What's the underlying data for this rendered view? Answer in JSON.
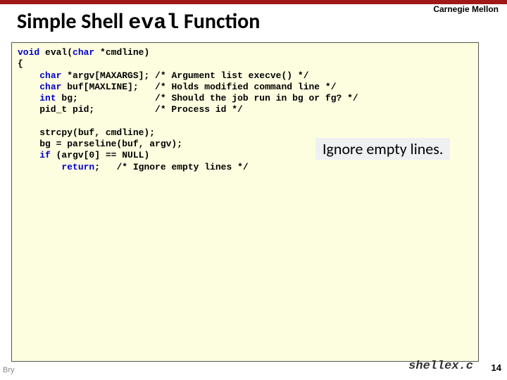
{
  "header": {
    "university": "Carnegie Mellon",
    "title_pre": "Simple Shell ",
    "title_code": "eval",
    "title_post": " Function"
  },
  "code": {
    "l1a": "void",
    "l1b": " eval(",
    "l1c": "char",
    "l1d": " *cmdline)",
    "l2": "{",
    "l3a": "    ",
    "l3b": "char",
    "l3c": " *argv[MAXARGS]; /* Argument list execve() */",
    "l4a": "    ",
    "l4b": "char",
    "l4c": " buf[MAXLINE];   /* Holds modified command line */",
    "l5a": "    ",
    "l5b": "int",
    "l5c": " bg;              /* Should the job run in bg or fg? */",
    "l6": "    pid_t pid;           /* Process id */",
    "blank1": "",
    "l7": "    strcpy(buf, cmdline);",
    "l8": "    bg = parseline(buf, argv);",
    "l9a": "    ",
    "l9b": "if",
    "l9c": " (argv[0] == NULL)",
    "l10a": "        ",
    "l10b": "return",
    "l10c": ";   /* Ignore empty lines */"
  },
  "annotation": {
    "a1": "Ignore empty lines."
  },
  "footer": {
    "filename": "shellex.c",
    "pagenum": "14",
    "left": "Bry"
  }
}
